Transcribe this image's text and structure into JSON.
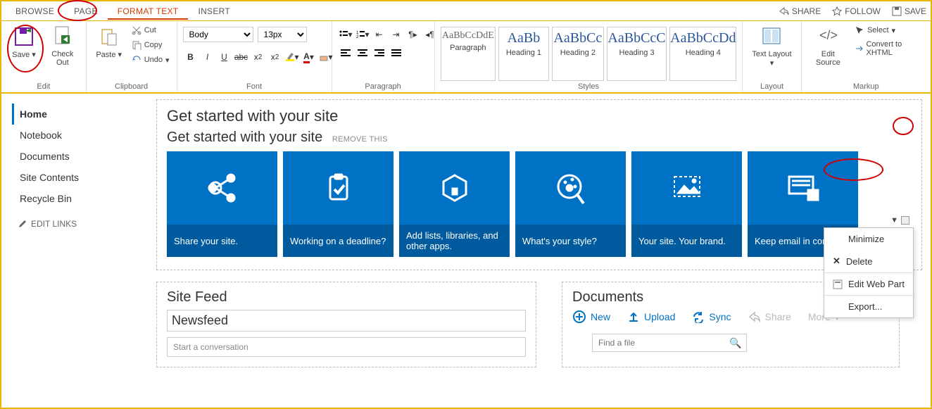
{
  "tabs": {
    "browse": "BROWSE",
    "page": "PAGE",
    "format": "FORMAT TEXT",
    "insert": "INSERT"
  },
  "topActions": {
    "share": "SHARE",
    "follow": "FOLLOW",
    "save": "SAVE"
  },
  "ribbon": {
    "edit": {
      "save": "Save",
      "checkout": "Check Out",
      "label": "Edit"
    },
    "clipboard": {
      "paste": "Paste",
      "cut": "Cut",
      "copy": "Copy",
      "undo": "Undo",
      "label": "Clipboard"
    },
    "font": {
      "family": "Body",
      "size": "13px",
      "label": "Font"
    },
    "paragraph": {
      "label": "Paragraph"
    },
    "styles": {
      "label": "Styles",
      "items": [
        {
          "preview": "AaBbCcDdE",
          "label": "Paragraph",
          "para": true
        },
        {
          "preview": "AaBb",
          "label": "Heading 1"
        },
        {
          "preview": "AaBbCc",
          "label": "Heading 2"
        },
        {
          "preview": "AaBbCcC",
          "label": "Heading 3"
        },
        {
          "preview": "AaBbCcDd",
          "label": "Heading 4"
        }
      ]
    },
    "layout": {
      "text": "Text Layout",
      "label": "Layout"
    },
    "markup": {
      "edit": "Edit Source",
      "select": "Select",
      "convert": "Convert to XHTML",
      "label": "Markup"
    }
  },
  "sidebar": {
    "items": [
      "Home",
      "Notebook",
      "Documents",
      "Site Contents",
      "Recycle Bin"
    ],
    "edit": "EDIT LINKS"
  },
  "getstarted": {
    "title": "Get started with your site",
    "inner": "Get started with your site",
    "remove": "REMOVE THIS",
    "tiles": [
      "Share your site.",
      "Working on a deadline?",
      "Add lists, libraries, and other apps.",
      "What's your style?",
      "Your site. Your brand.",
      "Keep email in context."
    ]
  },
  "menu": {
    "minimize": "Minimize",
    "delete": "Delete",
    "editwp": "Edit Web Part",
    "export": "Export..."
  },
  "feed": {
    "title": "Site Feed",
    "newsfeed": "Newsfeed",
    "placeholder": "Start a conversation"
  },
  "docs": {
    "title": "Documents",
    "new": "New",
    "upload": "Upload",
    "sync": "Sync",
    "share": "Share",
    "more": "More",
    "search": "Find a file"
  }
}
